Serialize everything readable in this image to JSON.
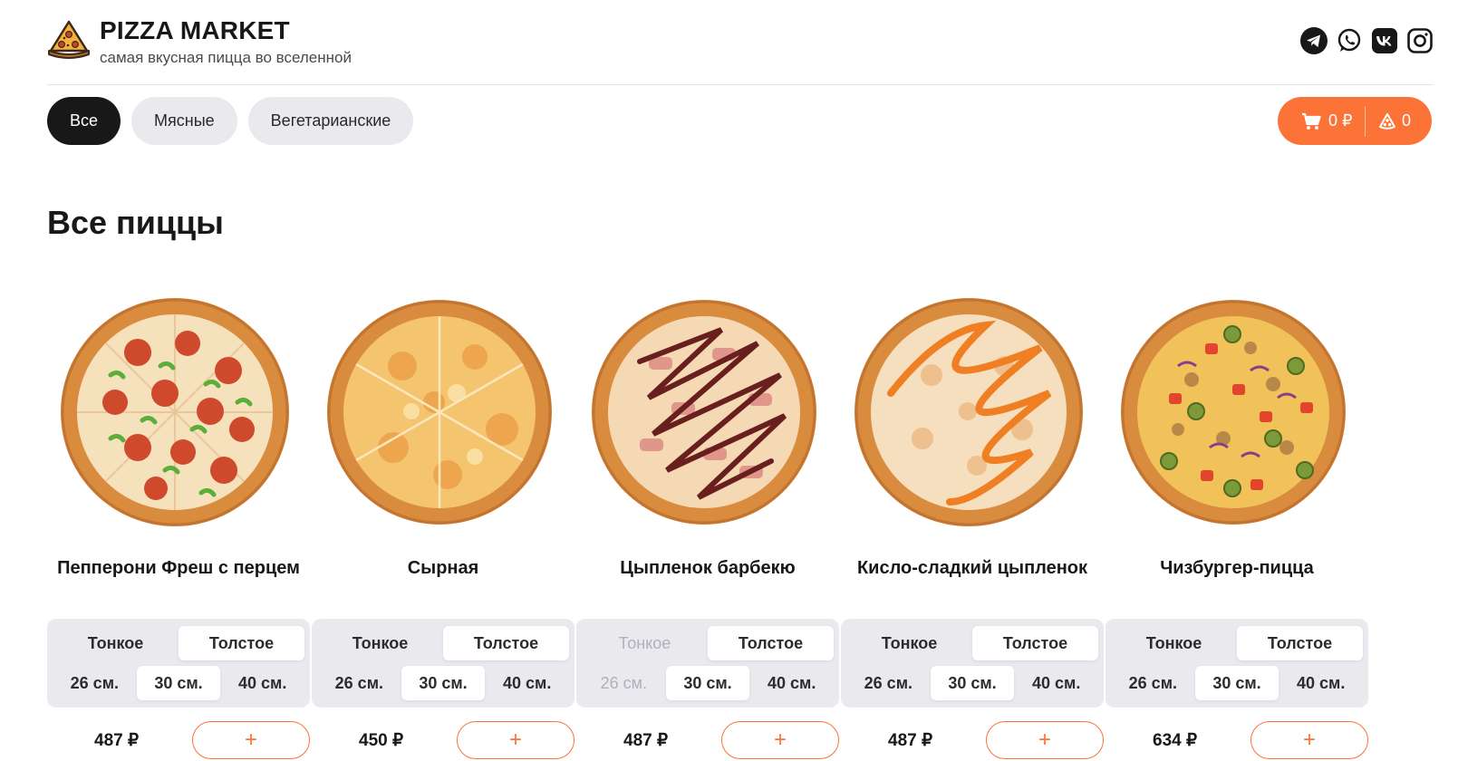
{
  "brand": {
    "title": "PIZZA MARKET",
    "subtitle": "самая вкусная пицца во вселенной"
  },
  "socials": [
    {
      "icon": "telegram-icon"
    },
    {
      "icon": "whatsapp-icon"
    },
    {
      "icon": "vk-icon"
    },
    {
      "icon": "instagram-icon"
    }
  ],
  "categories": [
    {
      "label": "Все",
      "active": true
    },
    {
      "label": "Мясные",
      "active": false
    },
    {
      "label": "Вегетарианские",
      "active": false
    }
  ],
  "cart": {
    "total": "0 ₽",
    "count": "0"
  },
  "page_title": "Все пиццы",
  "pizzas": [
    {
      "name": "Пепперони Фреш с перцем",
      "types": [
        "Тонкое",
        "Толстое"
      ],
      "sizes": [
        "26 см.",
        "30 см.",
        "40 см."
      ],
      "price": "487 ₽",
      "add_label": "+"
    },
    {
      "name": "Сырная",
      "types": [
        "Тонкое",
        "Толстое"
      ],
      "sizes": [
        "26 см.",
        "30 см.",
        "40 см."
      ],
      "price": "450 ₽",
      "add_label": "+"
    },
    {
      "name": "Цыпленок барбекю",
      "types": [
        "Тонкое",
        "Толстое"
      ],
      "sizes": [
        "26 см.",
        "30 см.",
        "40 см."
      ],
      "price": "487 ₽",
      "add_label": "+"
    },
    {
      "name": "Кисло-сладкий цыпленок",
      "types": [
        "Тонкое",
        "Толстое"
      ],
      "sizes": [
        "26 см.",
        "30 см.",
        "40 см."
      ],
      "price": "487 ₽",
      "add_label": "+"
    },
    {
      "name": "Чизбургер-пицца",
      "types": [
        "Тонкое",
        "Толстое"
      ],
      "sizes": [
        "26 см.",
        "30 см.",
        "40 см."
      ],
      "price": "634 ₽",
      "add_label": "+"
    }
  ],
  "colors": {
    "accent": "#fb7336",
    "dark": "#181818",
    "chip": "#e9e9ee"
  }
}
